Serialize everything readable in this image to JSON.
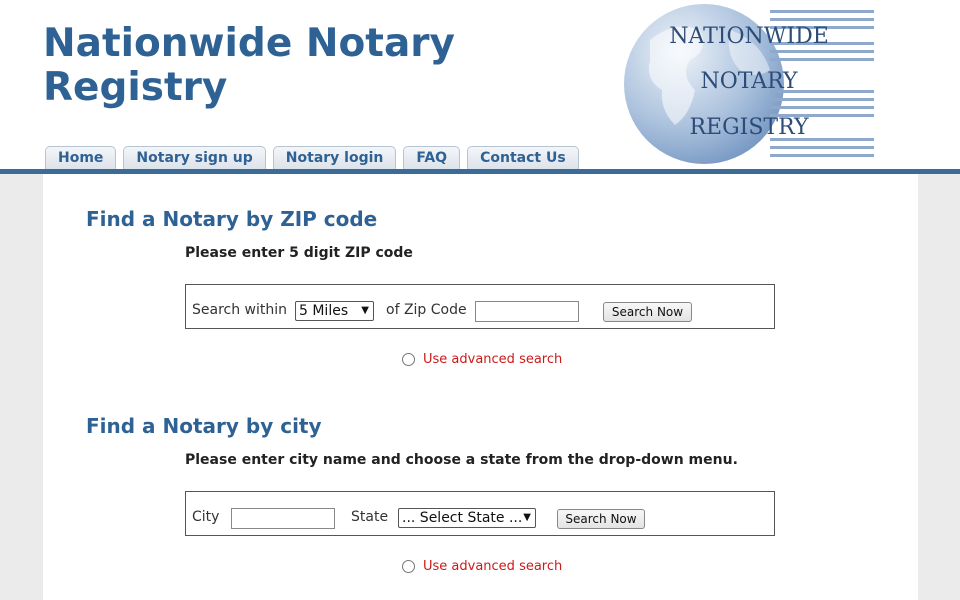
{
  "header": {
    "site_title": "Nationwide Notary Registry",
    "logo_line1": "NATIONWIDE",
    "logo_line2": "NOTARY",
    "logo_line3": "REGISTRY",
    "logo_icon": "globe-icon"
  },
  "nav": {
    "tabs": [
      {
        "label": "Home"
      },
      {
        "label": "Notary sign up"
      },
      {
        "label": "Notary login"
      },
      {
        "label": "FAQ"
      },
      {
        "label": "Contact Us"
      }
    ]
  },
  "zip_search": {
    "title": "Find a Notary by ZIP code",
    "instruction": "Please enter 5 digit ZIP code",
    "within_label": "Search within",
    "radius_value": "5 Miles",
    "zip_label": "of Zip Code",
    "zip_value": "",
    "button": "Search Now",
    "advanced": "Use advanced search"
  },
  "city_search": {
    "title": "Find a Notary by city",
    "instruction": "Please enter city name and choose a state from the drop-down menu.",
    "city_label": "City",
    "city_value": "",
    "state_label": "State",
    "state_value": "... Select State ...",
    "button": "Search Now",
    "advanced": "Use advanced search"
  },
  "colors": {
    "brand_blue": "#2f6294",
    "bar_blue": "#3b6b97",
    "link_red": "#cc1a1a",
    "page_bg": "#ebebeb"
  }
}
